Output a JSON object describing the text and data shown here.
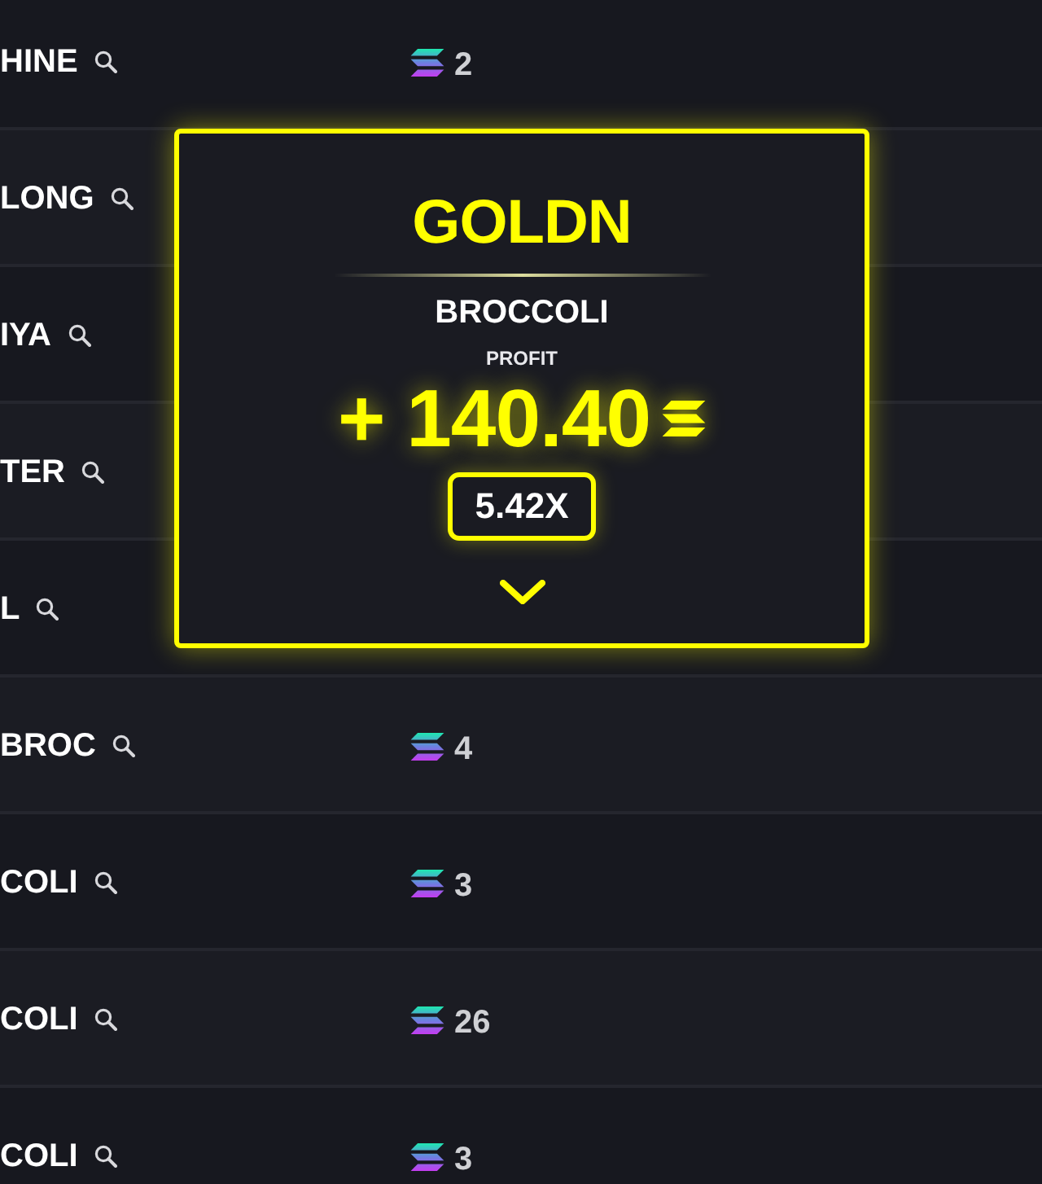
{
  "rows": [
    {
      "name": "HINE",
      "count": "2"
    },
    {
      "name": "LONG"
    },
    {
      "name": "IYA"
    },
    {
      "name": "TER"
    },
    {
      "name": "L"
    },
    {
      "name": "BROC",
      "count": "4"
    },
    {
      "name": "COLI",
      "count": "3"
    },
    {
      "name": "COLI",
      "count": "26"
    },
    {
      "name": "COLI",
      "count": "3"
    }
  ],
  "card": {
    "title": "GOLDN",
    "token": "BROCCOLI",
    "profit_label": "PROFIT",
    "profit": "+ 140.40",
    "multiplier": "5.42X"
  }
}
